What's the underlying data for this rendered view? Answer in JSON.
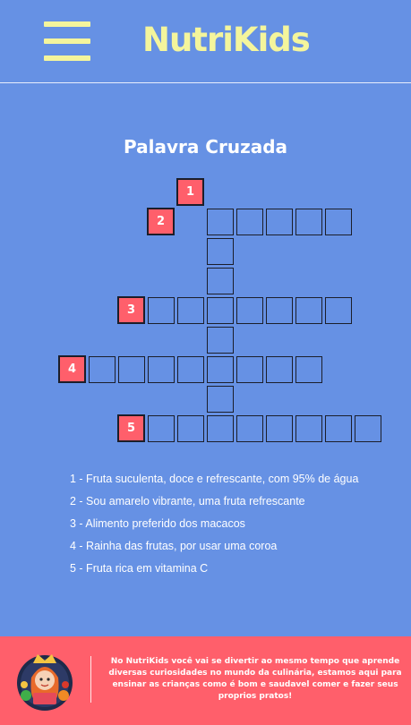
{
  "header": {
    "brand": "NutriKids",
    "menu_icon": "hamburger-menu-icon",
    "accent_color": "#f4f59c"
  },
  "puzzle": {
    "title": "Palavra Cruzada",
    "numbers": [
      "1",
      "2",
      "3",
      "4",
      "5"
    ],
    "clues": [
      "1 - Fruta suculenta, doce e refrescante, com 95% de água",
      "2 - Sou amarelo vibrante, uma fruta refrescante",
      "3 - Alimento preferido dos macacos",
      "4 - Rainha das frutas, por usar uma coroa",
      "5 - Fruta rica em vitamina C"
    ]
  },
  "footer": {
    "text": "No NutriKids você vai se divertir ao mesmo tempo que aprende diversas curiosidades no mundo da culinária, estamos aqui para ensinar as crianças como é bom e saudavel comer e fazer seus proprios pratos!",
    "avatar_icon": "chef-girl-avatar-icon"
  },
  "colors": {
    "background": "#6691e4",
    "number_cell": "#ff5f6b",
    "footer": "#ff5f6b"
  }
}
